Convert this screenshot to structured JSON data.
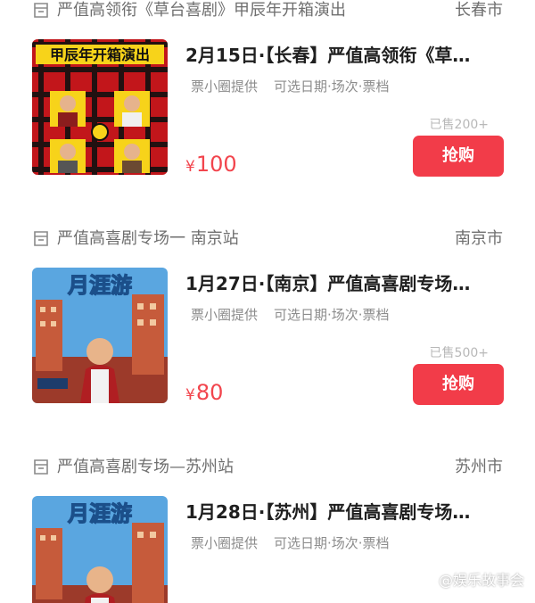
{
  "events": [
    {
      "store": "严值高领衔《草台喜剧》甲辰年开箱演出",
      "city": "长春市",
      "title": "2月15日·【长春】严值高领衔《草…",
      "provider": "票小圈提供",
      "options": "可选日期·场次·票档",
      "sold": "已售200+",
      "currency": "¥",
      "price": "100",
      "buy_label": "抢购",
      "poster_headline": "甲辰年开箱演出",
      "poster_theme": "red-black-plaid"
    },
    {
      "store": "严值高喜剧专场一 南京站",
      "city": "南京市",
      "title": "1月27日·【南京】严值高喜剧专场…",
      "provider": "票小圈提供",
      "options": "可选日期·场次·票档",
      "sold": "已售500+",
      "currency": "¥",
      "price": "80",
      "buy_label": "抢购",
      "poster_headline": "月涯游",
      "poster_theme": "blue-sky-city"
    },
    {
      "store": "严值高喜剧专场—苏州站",
      "city": "苏州市",
      "title": "1月28日·【苏州】严值高喜剧专场…",
      "provider": "票小圈提供",
      "options": "可选日期·场次·票档",
      "poster_headline": "月涯游",
      "poster_theme": "blue-sky-city"
    }
  ],
  "watermark": "@娱乐故事会",
  "colors": {
    "accent": "#f23c49",
    "price": "#f2454d",
    "muted": "#8c8c8c"
  }
}
